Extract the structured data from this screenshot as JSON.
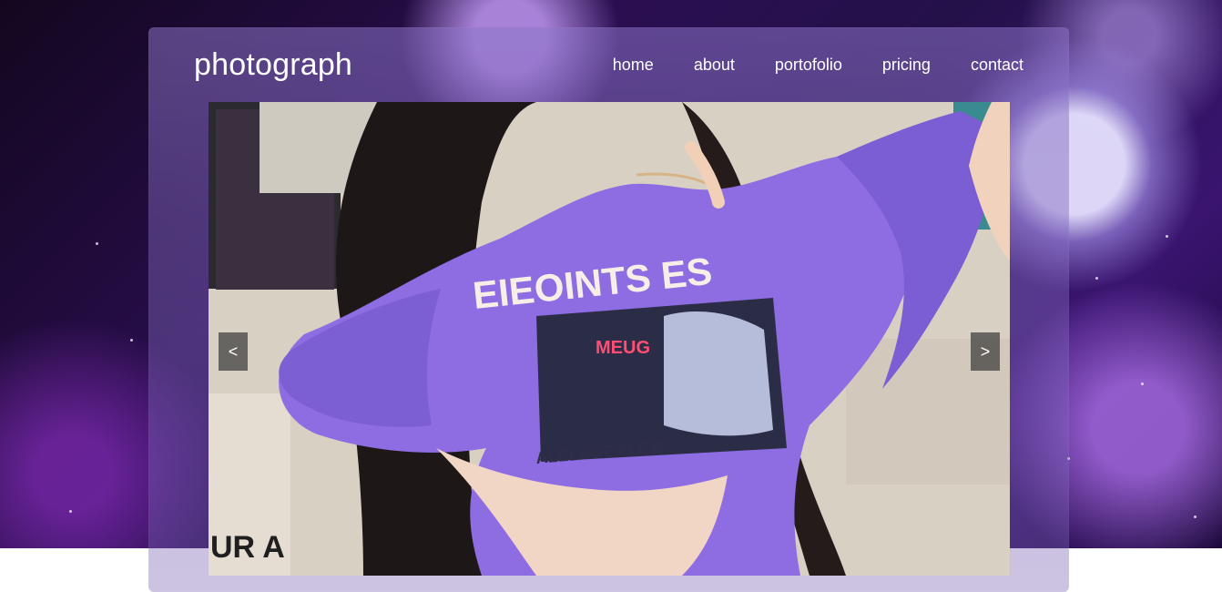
{
  "site": {
    "logo": "photograph"
  },
  "nav": {
    "items": [
      "home",
      "about",
      "portofolio",
      "pricing",
      "contact"
    ]
  },
  "slider": {
    "prev_label": "<",
    "next_label": ">",
    "image_text": {
      "shirt_main": "EIEOINTS ES",
      "shirt_sub": "MEUG",
      "shirt_bottom": "ALELAGE FLEW",
      "poster": "UR A"
    }
  }
}
